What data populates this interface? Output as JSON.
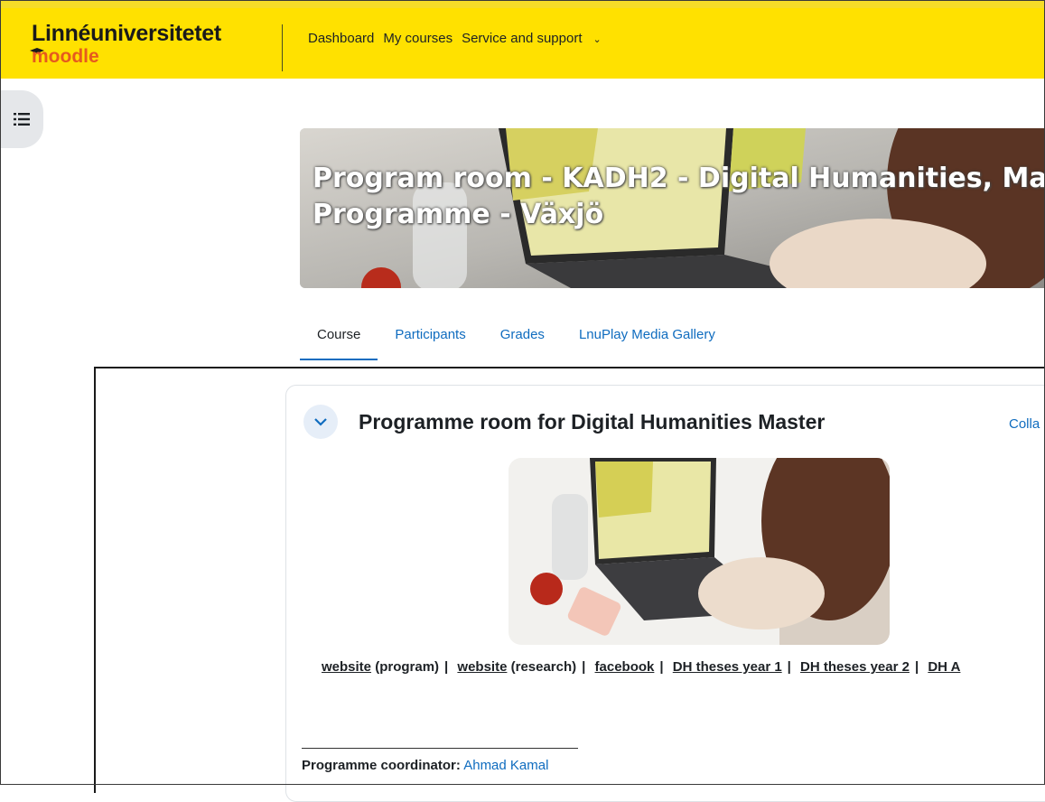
{
  "brand": {
    "line1": "Linnéuniversitetet",
    "line2": "moodle"
  },
  "nav": {
    "items": [
      "Dashboard",
      "My courses",
      "Service and support"
    ],
    "dropdown_icon": "chevron-down-icon"
  },
  "drawer": {
    "icon": "list-icon"
  },
  "hero": {
    "title_line1": "Program room - KADH2 - Digital Humanities, Ma",
    "title_line2": "Programme - Växjö"
  },
  "tabs": [
    "Course",
    "Participants",
    "Grades",
    "LnuPlay Media Gallery"
  ],
  "section": {
    "title": "Programme room for Digital Humanities Master",
    "collapse_label": "Colla"
  },
  "links": {
    "website_program": "website",
    "website_program_suffix": " (program)",
    "website_research": "website",
    "website_research_suffix": " (research)",
    "facebook": "facebook",
    "theses1": "DH theses year 1",
    "theses2": "DH theses year 2",
    "dh_a": "DH A"
  },
  "coordinator": {
    "label": "Programme coordinator:",
    "name": "Ahmad Kamal"
  },
  "colors": {
    "navbar": "#ffe100",
    "link": "#0f6cbf",
    "brand_orange": "#e65a1e"
  }
}
